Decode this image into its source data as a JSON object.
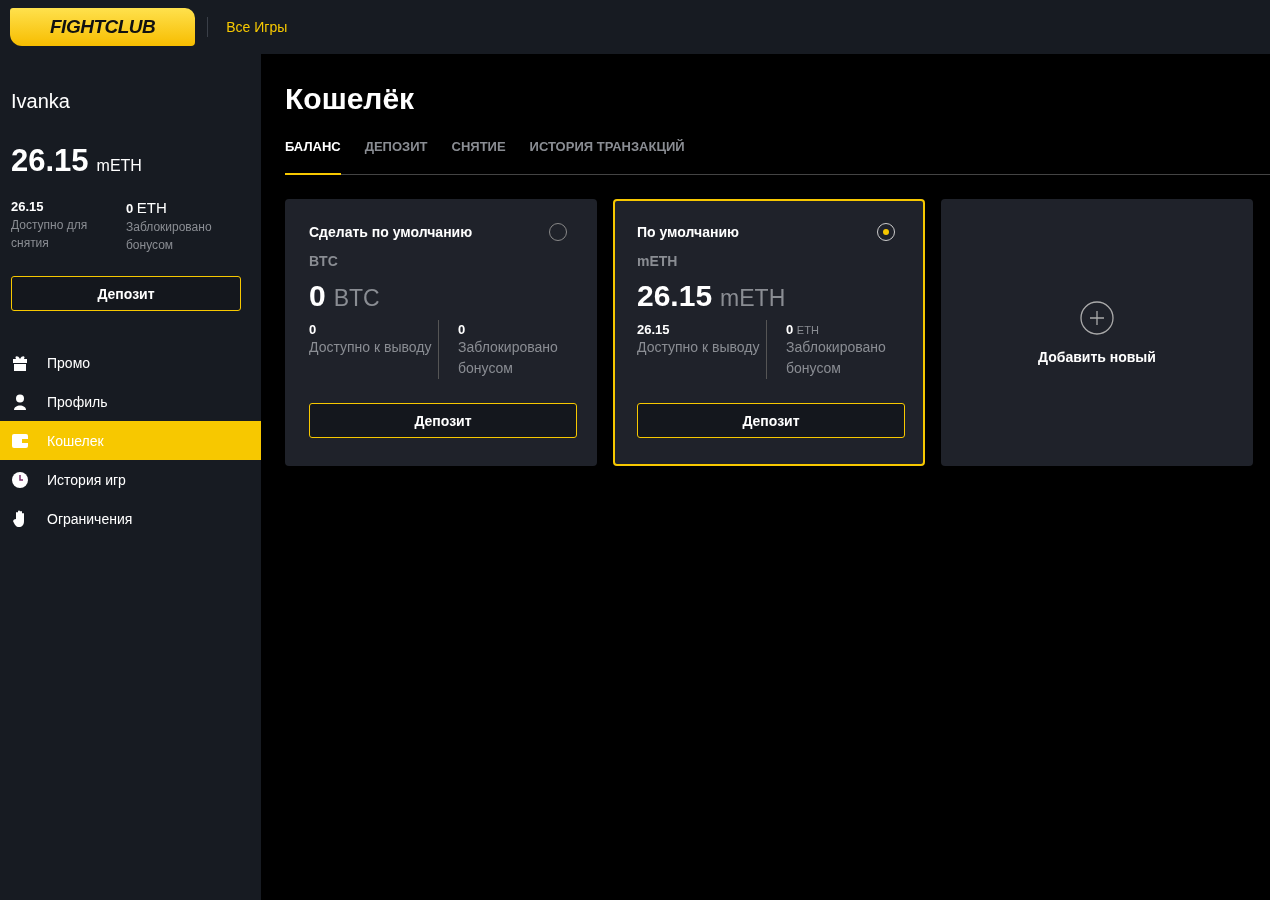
{
  "header": {
    "logo": "FIGHTCLUB",
    "nav_link": "Все Игры"
  },
  "sidebar": {
    "username": "Ivanka",
    "balance_amount": "26.15",
    "balance_unit": "mETH",
    "available": {
      "value": "26.15",
      "label": "Доступно для снятия"
    },
    "locked": {
      "value": "0",
      "unit": "ETH",
      "label": "Заблокировано бонусом"
    },
    "deposit_button": "Депозит",
    "items": [
      {
        "label": "Промо",
        "kind": "promo",
        "selected": false
      },
      {
        "label": "Профиль",
        "kind": "profile",
        "selected": false
      },
      {
        "label": "Кошелек",
        "kind": "wallet",
        "selected": true
      },
      {
        "label": "История игр",
        "kind": "history",
        "selected": false
      },
      {
        "label": "Ограничения",
        "kind": "limits",
        "selected": false
      }
    ]
  },
  "page": {
    "title": "Кошелёк",
    "tabs": [
      {
        "label": "БАЛАНС",
        "selected": true
      },
      {
        "label": "ДЕПОЗИТ",
        "selected": false
      },
      {
        "label": "СНЯТИЕ",
        "selected": false
      },
      {
        "label": "ИСТОРИЯ ТРАНЗАКЦИЙ",
        "selected": false
      }
    ],
    "wallets": [
      {
        "kind": "wallet",
        "default_label": "Сделать по умолчанию",
        "selected": false,
        "currency": "BTC",
        "amount": "0",
        "unit": "BTC",
        "available_value": "0",
        "available_label": "Доступно к выводу",
        "locked_value": "0",
        "locked_label": "Заблокировано бонусом",
        "button": "Депозит"
      },
      {
        "kind": "wallet",
        "default_label": "По умолчанию",
        "selected": true,
        "currency": "mETH",
        "amount": "26.15",
        "unit": "mETH",
        "available_value": "26.15",
        "available_label": "Доступно к выводу",
        "locked_value": "0",
        "locked_unit": "ETH",
        "locked_label": "Заблокировано бонусом",
        "button": "Депозит"
      },
      {
        "kind": "add",
        "label": "Добавить новый"
      }
    ]
  }
}
